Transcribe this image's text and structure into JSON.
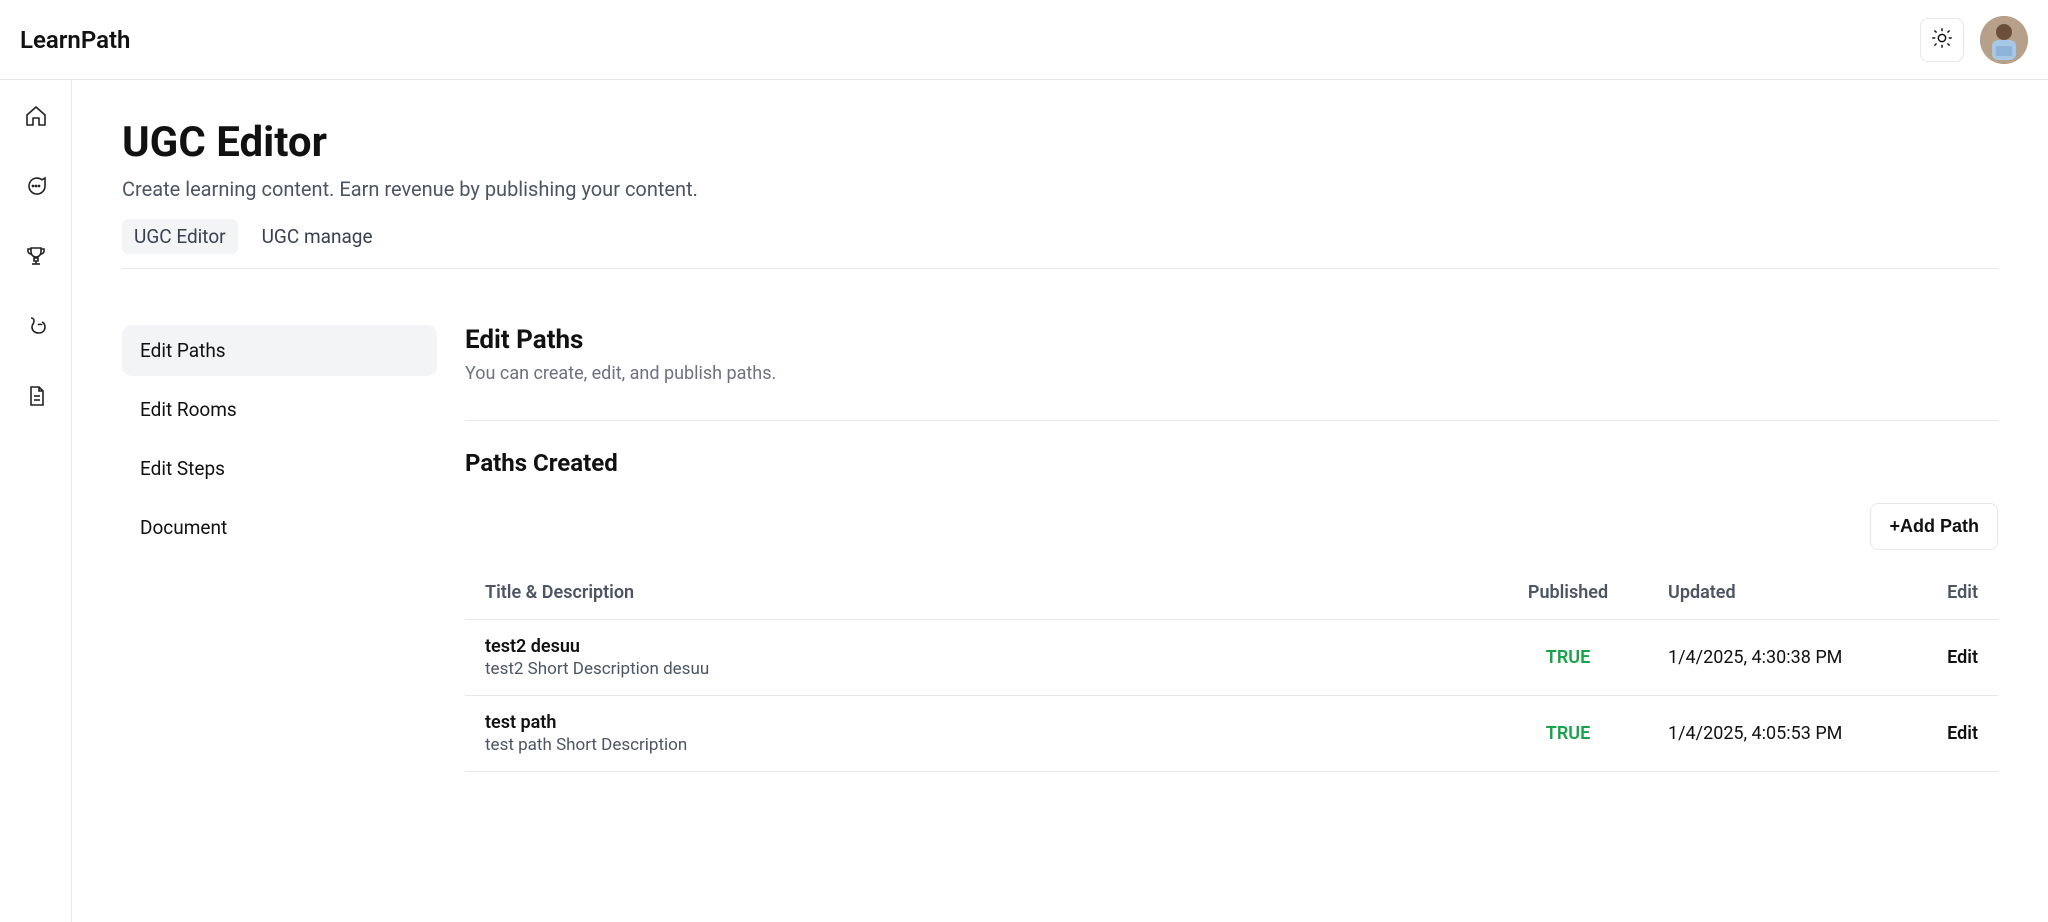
{
  "brand": "LearnPath",
  "topbar": {
    "theme_icon": "sun-icon",
    "avatar": "user-avatar"
  },
  "rail": {
    "items": [
      {
        "name": "home-icon"
      },
      {
        "name": "chat-icon"
      },
      {
        "name": "trophy-icon"
      },
      {
        "name": "muscle-icon"
      },
      {
        "name": "document-icon"
      }
    ]
  },
  "page": {
    "title": "UGC Editor",
    "subtitle": "Create learning content. Earn revenue by publishing your content."
  },
  "tabs": [
    {
      "label": "UGC Editor",
      "active": true
    },
    {
      "label": "UGC manage",
      "active": false
    }
  ],
  "side_nav": [
    {
      "label": "Edit Paths",
      "active": true
    },
    {
      "label": "Edit Rooms",
      "active": false
    },
    {
      "label": "Edit Steps",
      "active": false
    },
    {
      "label": "Document",
      "active": false
    }
  ],
  "section": {
    "heading": "Edit Paths",
    "description": "You can create, edit, and publish paths."
  },
  "subsection": {
    "heading": "Paths Created",
    "add_button": "+Add Path"
  },
  "table": {
    "columns": {
      "title": "Title & Description",
      "published": "Published",
      "updated": "Updated",
      "edit": "Edit"
    },
    "rows": [
      {
        "title": "test2 desuu",
        "description": "test2 Short Description desuu",
        "published": "TRUE",
        "updated": "1/4/2025, 4:30:38 PM",
        "edit_label": "Edit"
      },
      {
        "title": "test path",
        "description": "test path Short Description",
        "published": "TRUE",
        "updated": "1/4/2025, 4:05:53 PM",
        "edit_label": "Edit"
      }
    ]
  }
}
